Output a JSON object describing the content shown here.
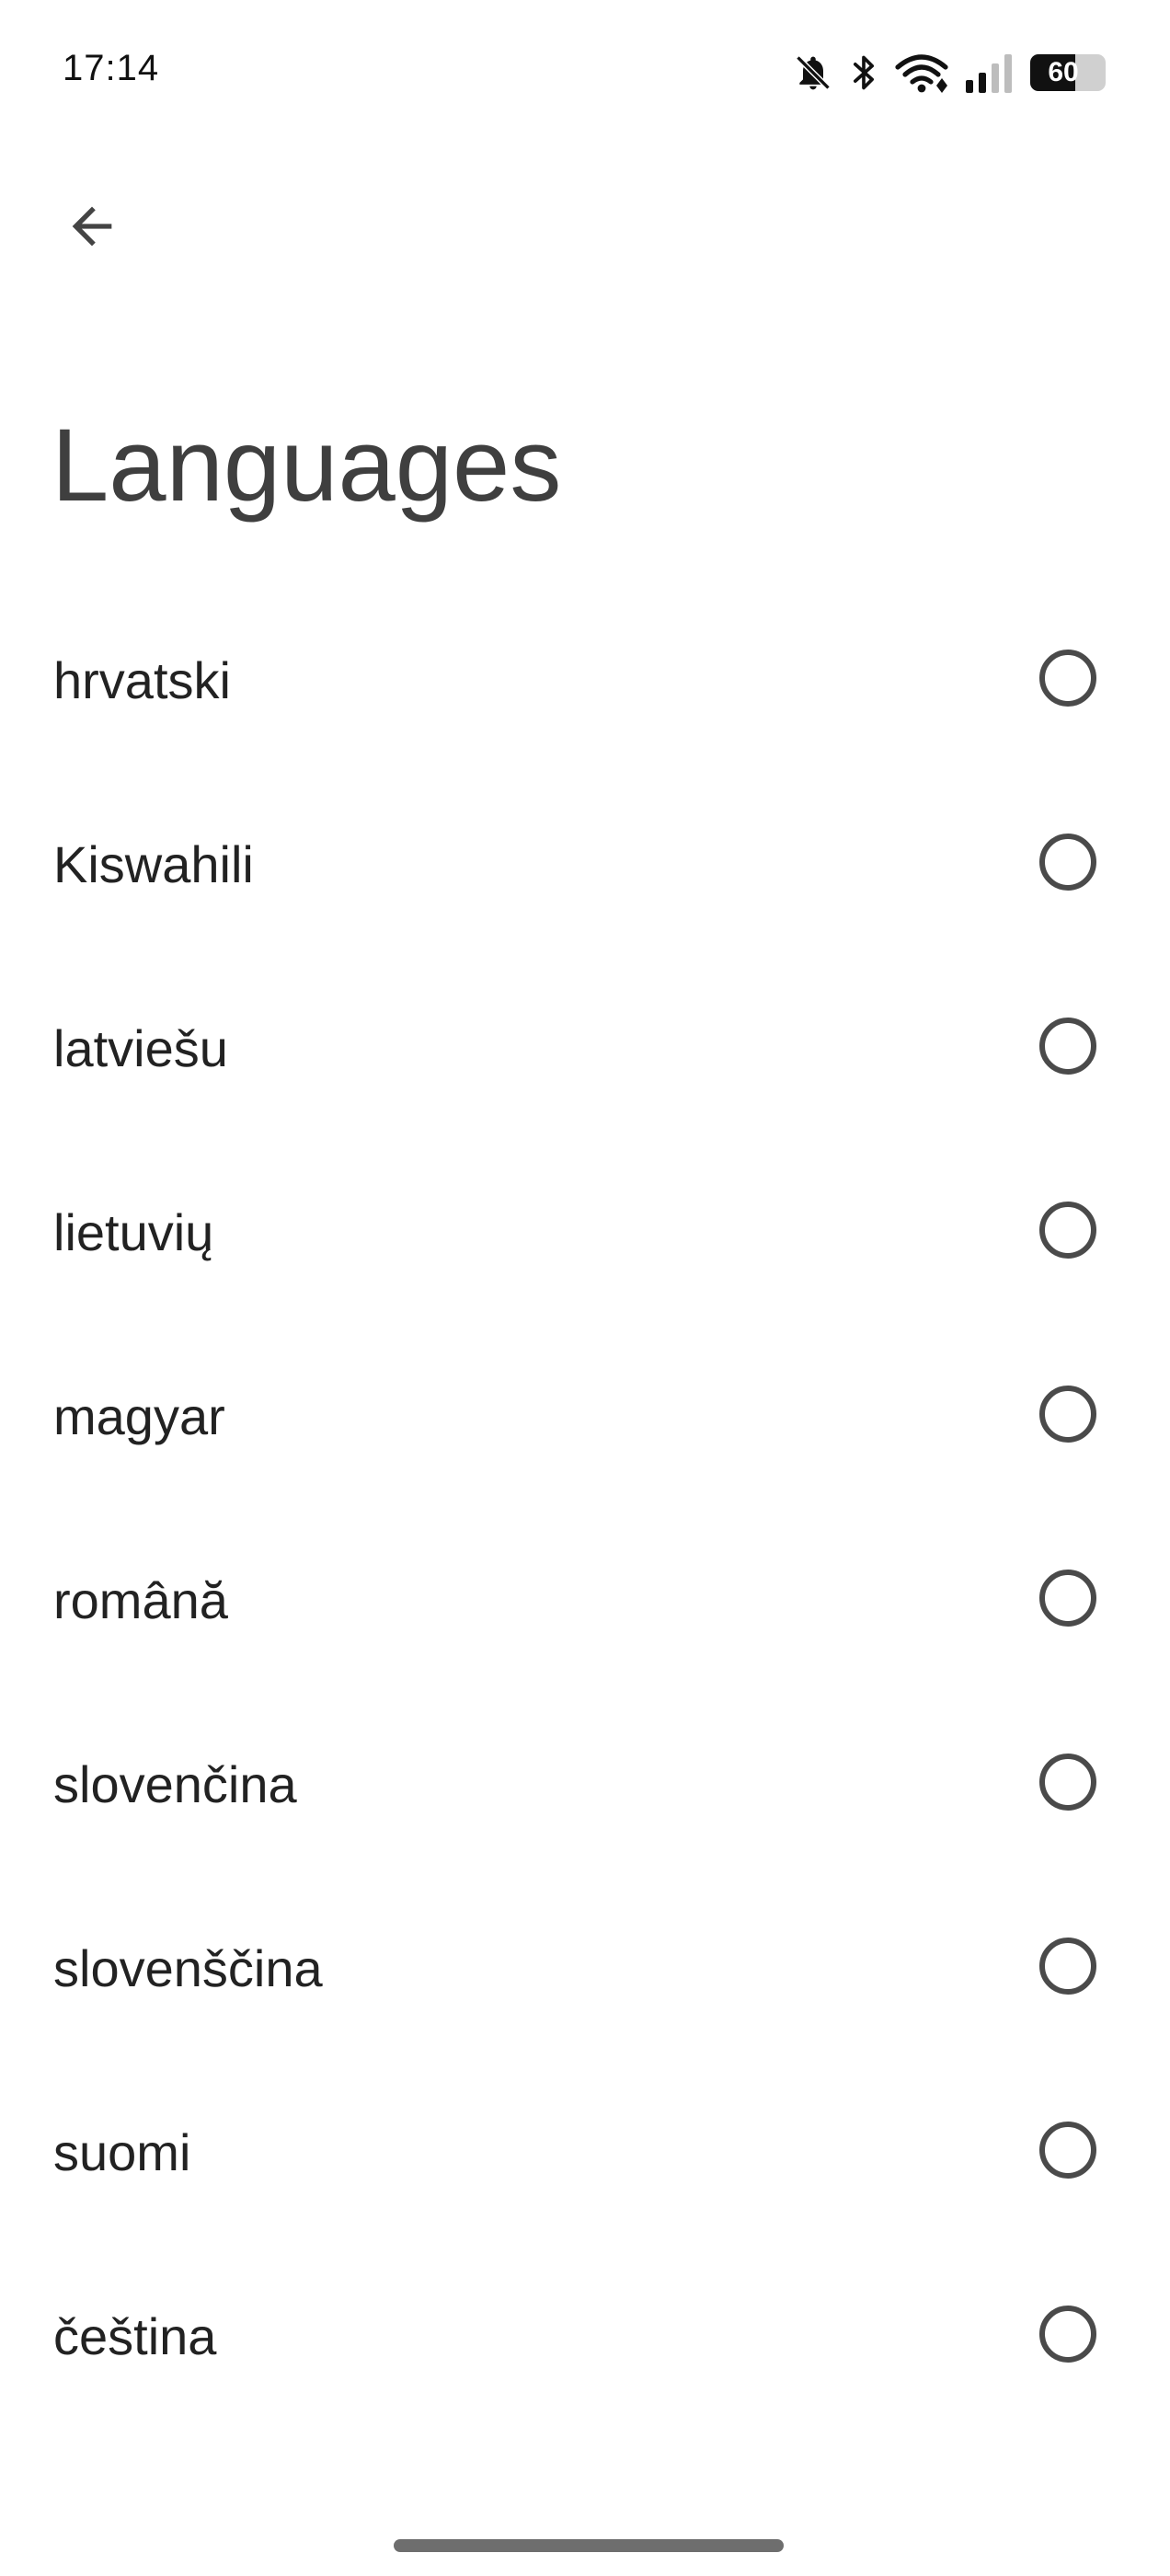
{
  "status_bar": {
    "time": "17:14",
    "icons": [
      "bell-off-icon",
      "bluetooth-icon",
      "wifi-icon",
      "cellular-signal-icon",
      "battery-icon"
    ],
    "battery_level": "60",
    "battery_fraction": 0.6
  },
  "app_bar": {
    "back_icon": "arrow-back-icon",
    "title": "Languages"
  },
  "languages": {
    "items": [
      {
        "label": "",
        "selected": false
      },
      {
        "label": "hrvatski",
        "selected": false
      },
      {
        "label": "Kiswahili",
        "selected": false
      },
      {
        "label": "latviešu",
        "selected": false
      },
      {
        "label": "lietuvių",
        "selected": false
      },
      {
        "label": "magyar",
        "selected": false
      },
      {
        "label": "română",
        "selected": false
      },
      {
        "label": "slovenčina",
        "selected": false
      },
      {
        "label": "slovenščina",
        "selected": false
      },
      {
        "label": "suomi",
        "selected": false
      },
      {
        "label": "čeština",
        "selected": false
      }
    ]
  },
  "colors": {
    "background": "#ffffff",
    "title": "#3f3f3f",
    "radio_outline": "#4a4a4a",
    "gesture_bar": "#6e6e6e"
  }
}
